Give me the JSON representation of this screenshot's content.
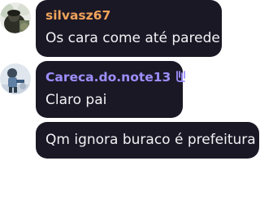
{
  "messages": [
    {
      "username": "silvasz67",
      "username_color": "#f0a35a",
      "text": "Os cara come até parede",
      "avatar_icon": "user-avatar-dark-photo"
    },
    {
      "username": "Careca.do.note13",
      "username_color": "#9d8fff",
      "text": "Claro pai",
      "avatar_icon": "user-avatar-light-photo",
      "badge_icon": "currency-badge-icon"
    },
    {
      "text": "Qm ignora buraco é prefeitura"
    }
  ],
  "colors": {
    "bubble_bg": "#1b1826",
    "text": "#f2f2f4",
    "page_bg": "#ffffff"
  }
}
